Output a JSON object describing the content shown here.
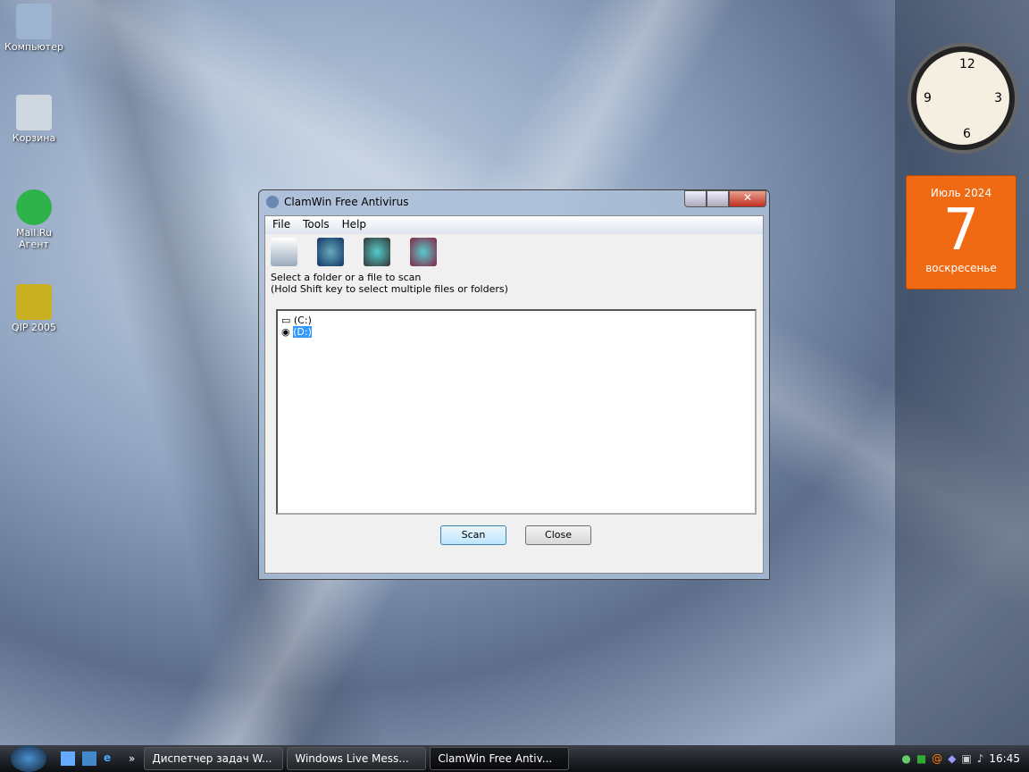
{
  "desktop_icons": [
    {
      "label": "Компьютер"
    },
    {
      "label": "Корзина"
    },
    {
      "label": "Mail.Ru Агент"
    },
    {
      "label": "QIP 2005"
    }
  ],
  "gadgets": {
    "calendar": {
      "month_year": "Июль 2024",
      "day": "7",
      "weekday": "воскресенье"
    },
    "clock": {
      "numbers": [
        "12",
        "3",
        "6",
        "9"
      ]
    }
  },
  "window": {
    "title": "ClamWin Free Antivirus",
    "menu": [
      "File",
      "Tools",
      "Help"
    ],
    "instructions": [
      "Select a folder or a file to scan",
      "(Hold Shift key to select multiple files or folders)"
    ],
    "drives": [
      "(C:)",
      "(D:)"
    ],
    "scan_label": "Scan",
    "close_label": "Close"
  },
  "taskbar": {
    "tasks": [
      "Диспетчер задач W...",
      "Windows Live Mess...",
      "ClamWin Free Antiv..."
    ],
    "time": "16:45",
    "overflow": "»"
  }
}
